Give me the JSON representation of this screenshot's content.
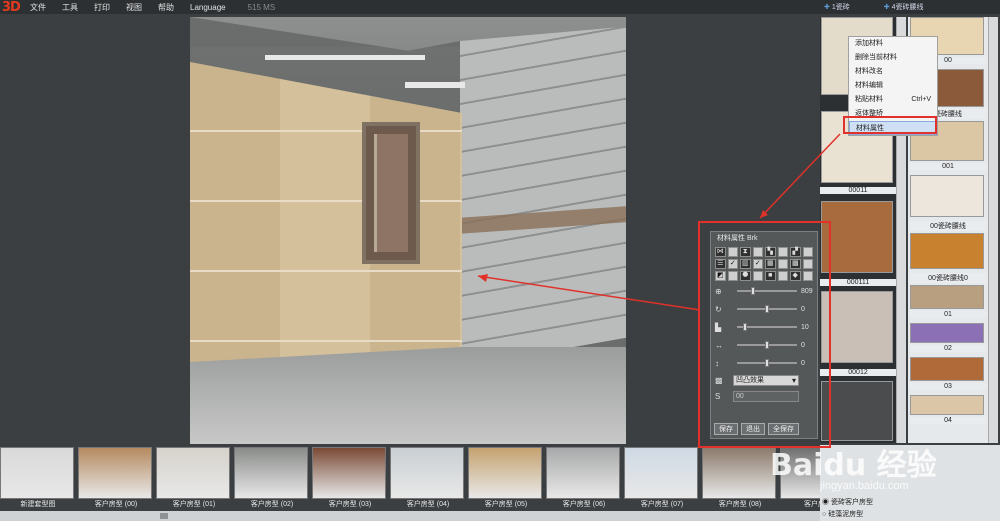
{
  "app": {
    "logo": "3D"
  },
  "menu": [
    "文件",
    "工具",
    "打印",
    "视图",
    "帮助",
    "Language"
  ],
  "status": "515 MS",
  "right_tabs": [
    "1瓷砖",
    "4瓷砖腰线"
  ],
  "properties": {
    "title": "材料属性 Brk",
    "sliders": [
      {
        "icon": "zoom-icon",
        "glyph": "⊕",
        "value": "809",
        "level": 0.25
      },
      {
        "icon": "rotate-icon",
        "glyph": "↻",
        "value": "0",
        "level": 0.5
      },
      {
        "icon": "corner-icon",
        "glyph": "▙",
        "value": "10",
        "level": 0.1
      },
      {
        "icon": "width-icon",
        "glyph": "↔",
        "value": "0",
        "level": 0.5
      },
      {
        "icon": "height-icon",
        "glyph": "↕",
        "value": "0",
        "level": 0.5
      }
    ],
    "bump_label": "凹凸效果",
    "s_value": "00",
    "buttons": {
      "save": "保存",
      "exit": "退出",
      "save_all": "全保存"
    }
  },
  "context_menu": {
    "items": [
      {
        "label": "添加材料",
        "shortcut": ""
      },
      {
        "label": "删除当前材料",
        "shortcut": ""
      },
      {
        "label": "材料改名",
        "shortcut": ""
      },
      {
        "label": "材料编辑",
        "shortcut": ""
      },
      {
        "label": "粘贴材料",
        "shortcut": "Ctrl+V"
      },
      {
        "label": "返体整矫",
        "shortcut": ""
      },
      {
        "label": "材料属性",
        "shortcut": ""
      }
    ]
  },
  "material_col1": [
    "00011",
    "000111",
    "00012"
  ],
  "material_col2": [
    "00",
    "瓷砖腰线",
    "001",
    "00瓷砖腰线",
    "00瓷砖腰线0",
    "01",
    "02",
    "03",
    "04"
  ],
  "thumbnails": [
    {
      "label": "新建套型图",
      "color": "#d9d9d9"
    },
    {
      "label": "客户房型 (00)",
      "color": "#b58a60"
    },
    {
      "label": "客户房型 (01)",
      "color": "#d6d2cc"
    },
    {
      "label": "客户房型 (02)",
      "color": "#8a8c8a"
    },
    {
      "label": "客户房型 (03)",
      "color": "#7a4a36"
    },
    {
      "label": "客户房型 (04)",
      "color": "#c9cfd3"
    },
    {
      "label": "客户房型 (05)",
      "color": "#c5a270"
    },
    {
      "label": "客户房型 (06)",
      "color": "#a8a9aa"
    },
    {
      "label": "客户房型 (07)",
      "color": "#cfd9e4"
    },
    {
      "label": "客户房型 (08)",
      "color": "#8c7a6c"
    },
    {
      "label": "客户房型",
      "color": "#6f6f6f"
    }
  ],
  "schemes": [
    "瓷砖客户房型",
    "硅藻泥房型"
  ],
  "watermark": {
    "main": "Baidu 经验",
    "sub": "jingyan.baidu.com"
  }
}
